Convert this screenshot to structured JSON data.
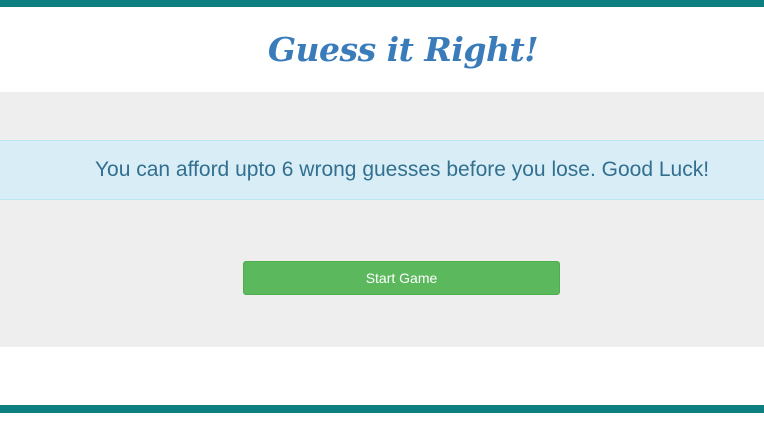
{
  "header": {
    "title": "Guess it Right!"
  },
  "alert": {
    "message": "You can afford upto 6 wrong guesses before you lose. Good Luck!"
  },
  "controls": {
    "start_label": "Start Game"
  },
  "colors": {
    "accent_bar": "#0e7f80",
    "title": "#3a7bba",
    "alert_bg": "#d9edf7",
    "alert_text": "#31708f",
    "button_bg": "#5cb85c",
    "button_border": "#4cae4c",
    "panel_bg": "#eeeeee"
  }
}
